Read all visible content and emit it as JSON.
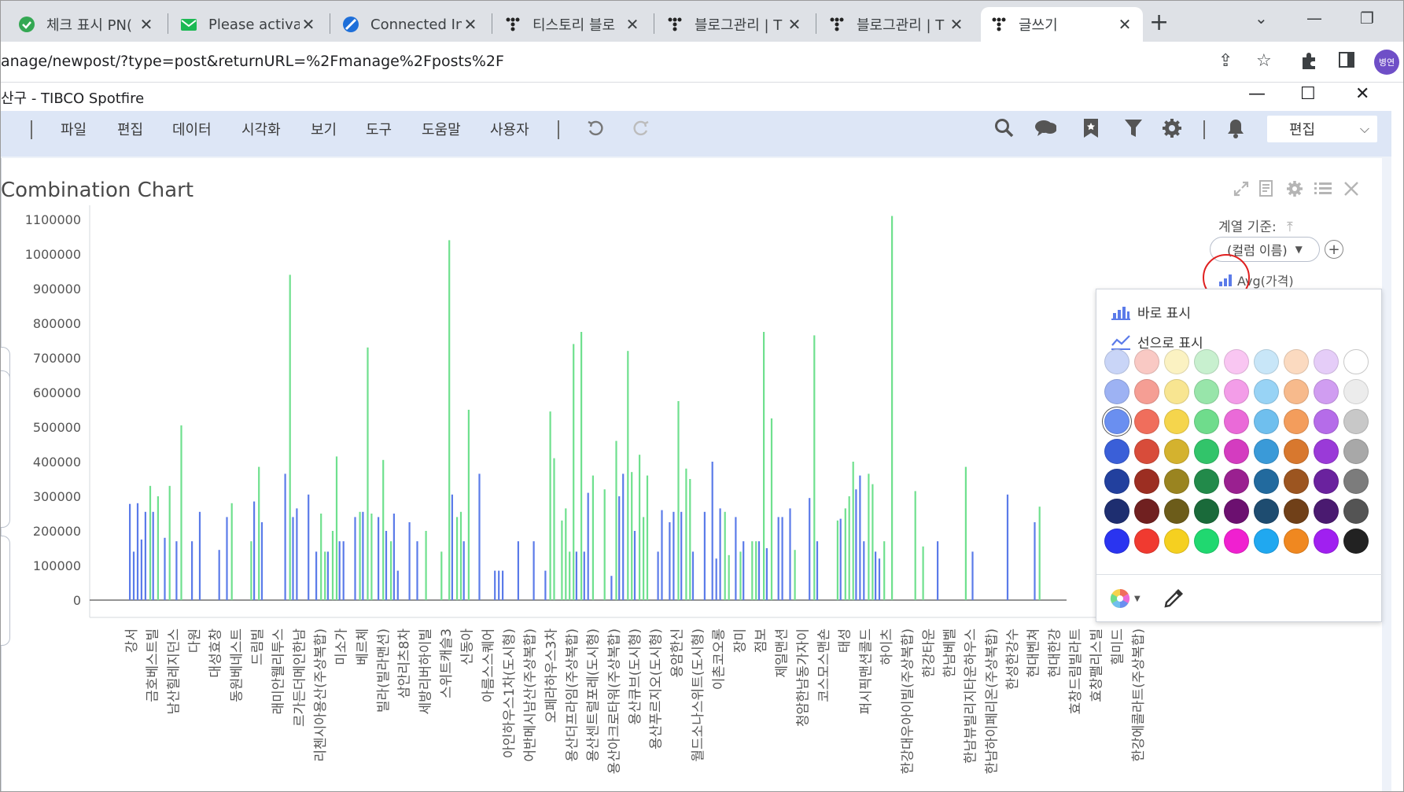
{
  "browser": {
    "tabs": [
      {
        "title": "체크 표시 PN(",
        "icon": "green-check-icon"
      },
      {
        "title": "Please activat",
        "icon": "green-mail-icon"
      },
      {
        "title": "Connected In",
        "icon": "blue-compass-icon"
      },
      {
        "title": "티스토리 블로",
        "icon": "tistory-icon"
      },
      {
        "title": "블로그관리 | T",
        "icon": "tistory-icon"
      },
      {
        "title": "블로그관리 | T",
        "icon": "tistory-icon"
      },
      {
        "title": "글쓰기",
        "icon": "tistory-icon"
      }
    ],
    "url": "anage/newpost/?type=post&returnURL=%2Fmanage%2Fposts%2F",
    "profile": "병연"
  },
  "app": {
    "title": "산구 - TIBCO Spotfire",
    "menu": [
      "파일",
      "편집",
      "데이터",
      "시각화",
      "보기",
      "도구",
      "도움말",
      "사용자"
    ],
    "mode": "편집"
  },
  "chart": {
    "title": "Combination Chart",
    "legend_label": "계열 기준:",
    "legend_dropdown": "(컬럼 이름)",
    "legend_item": "Avg(가격)"
  },
  "popup": {
    "bar_option": "바로 표시",
    "line_option": "선으로 표시",
    "colors": [
      [
        "#c9d5f7",
        "#f9c9c4",
        "#fbf2c2",
        "#c8f0cf",
        "#f9c6f2",
        "#c8e6f8",
        "#fbdac0",
        "#e5cdf8",
        "#ffffff"
      ],
      [
        "#9db2f3",
        "#f59e94",
        "#f8e591",
        "#98e5aa",
        "#f39de8",
        "#98d3f5",
        "#f7ba8c",
        "#d09df1",
        "#ececec"
      ],
      [
        "#6a8ff0",
        "#f06e5c",
        "#f5d54c",
        "#6fdc8c",
        "#ea6ad8",
        "#6fbfee",
        "#f39d5c",
        "#b56ce9",
        "#c8c8c8"
      ],
      [
        "#3a5fd8",
        "#d84c3a",
        "#d4b22e",
        "#32c46a",
        "#d43cc0",
        "#3a9ad8",
        "#d8782e",
        "#9a3ad8",
        "#a8a8a8"
      ],
      [
        "#22409e",
        "#9c2e22",
        "#9a8420",
        "#228a4a",
        "#9a2090",
        "#226a9e",
        "#9c5520",
        "#6a229e",
        "#7c7c7c"
      ],
      [
        "#1e2e70",
        "#702020",
        "#6c5c1a",
        "#1a6a3a",
        "#6c1070",
        "#1e4c70",
        "#704018",
        "#4a1a70",
        "#545454"
      ],
      [
        "#2a34f0",
        "#f03a30",
        "#f5d020",
        "#20d870",
        "#f020d0",
        "#20a8f0",
        "#f08820",
        "#a020f0",
        "#222222"
      ]
    ]
  },
  "chart_data": {
    "type": "bar",
    "title": "Combination Chart",
    "yticks": [
      "1100000",
      "1000000",
      "900000",
      "800000",
      "700000",
      "600000",
      "500000",
      "400000",
      "300000",
      "200000",
      "100000",
      "0"
    ],
    "ylim": [
      0,
      1100000
    ],
    "series": [
      {
        "name": "Avg(가격)",
        "color": "#5b7be9"
      },
      {
        "name": "",
        "color": "#6fe08e"
      }
    ],
    "x_labels": [
      "강서",
      "금호베스트빌",
      "남산힐레지던스",
      "다원",
      "대성효창",
      "동원베네스트",
      "드림빌",
      "래미안웰리투스",
      "르가든더메인한남",
      "리첸시아용산(주상복합)",
      "미소가",
      "베르체",
      "빌라(빌라맨션)",
      "삼안리츠8차",
      "세방리버하이빌",
      "스위트캐슬3",
      "신동아",
      "아름스스퀘어",
      "아인하우스1차(도시형)",
      "어반메시남산(주상복합)",
      "오페라하우스3차",
      "용산더프라임(주상복합)",
      "용산센트럴포레(도시형)",
      "용산아크로타워(주상복합)",
      "용산큐브(도시형)",
      "용산푸르지오(도시형)",
      "용암한신",
      "월드소나스위트(도시형)",
      "이촌코오롱",
      "장미",
      "점보",
      "제일맨션",
      "청암한남동가자이",
      "코스모스맨숀",
      "태성",
      "퍼시픽맨션콜드",
      "하이츠",
      "한강대우아이빌(주상복합)",
      "한강타운",
      "한남베벨",
      "한남뷰빌리지타운하우스",
      "한남하이페리온(주상복합)",
      "한성한강수",
      "현대벤쳐",
      "현대한강",
      "효창드림빌라트",
      "효창팰리스빌",
      "힐미드",
      "한강에콜라트(주상복합)"
    ],
    "bars": [
      [
        0,
        278000,
        0
      ],
      [
        1,
        140000,
        0
      ],
      [
        2,
        280000,
        0
      ],
      [
        3,
        175000,
        0
      ],
      [
        4,
        255000,
        0
      ],
      [
        5,
        0,
        330000
      ],
      [
        6,
        255000,
        0
      ],
      [
        7,
        0,
        300000
      ],
      [
        9,
        180000,
        0
      ],
      [
        10,
        0,
        330000
      ],
      [
        12,
        170000,
        0
      ],
      [
        13,
        0,
        505000
      ],
      [
        16,
        170000,
        0
      ],
      [
        18,
        255000,
        0
      ],
      [
        23,
        145000,
        0
      ],
      [
        25,
        240000,
        0
      ],
      [
        26,
        0,
        280000
      ],
      [
        31,
        0,
        170000
      ],
      [
        32,
        285000,
        0
      ],
      [
        33,
        0,
        385000
      ],
      [
        34,
        225000,
        0
      ],
      [
        40,
        365000,
        0
      ],
      [
        41,
        0,
        940000
      ],
      [
        42,
        240000,
        0
      ],
      [
        43,
        265000,
        0
      ],
      [
        46,
        305000,
        0
      ],
      [
        48,
        140000,
        0
      ],
      [
        49,
        0,
        250000
      ],
      [
        50,
        0,
        140000
      ],
      [
        51,
        140000,
        0
      ],
      [
        52,
        0,
        200000
      ],
      [
        53,
        0,
        415000
      ],
      [
        54,
        170000,
        0
      ],
      [
        55,
        170000,
        0
      ],
      [
        58,
        240000,
        0
      ],
      [
        59,
        0,
        255000
      ],
      [
        60,
        255000,
        0
      ],
      [
        61,
        0,
        730000
      ],
      [
        62,
        0,
        250000
      ],
      [
        64,
        240000,
        0
      ],
      [
        65,
        0,
        405000
      ],
      [
        66,
        200000,
        0
      ],
      [
        67,
        0,
        170000
      ],
      [
        68,
        250000,
        0
      ],
      [
        69,
        85000,
        0
      ],
      [
        72,
        225000,
        0
      ],
      [
        74,
        170000,
        0
      ],
      [
        76,
        0,
        200000
      ],
      [
        80,
        0,
        140000
      ],
      [
        82,
        0,
        1040000
      ],
      [
        83,
        305000,
        0
      ],
      [
        84,
        0,
        240000
      ],
      [
        85,
        0,
        255000
      ],
      [
        86,
        170000,
        0
      ],
      [
        87,
        0,
        550000
      ],
      [
        90,
        365000,
        0
      ],
      [
        94,
        85000,
        0
      ],
      [
        95,
        85000,
        0
      ],
      [
        96,
        85000,
        0
      ],
      [
        100,
        170000,
        0
      ],
      [
        104,
        170000,
        0
      ],
      [
        107,
        85000,
        0
      ],
      [
        108,
        0,
        545000
      ],
      [
        109,
        0,
        410000
      ],
      [
        111,
        0,
        230000
      ],
      [
        112,
        0,
        265000
      ],
      [
        113,
        0,
        140000
      ],
      [
        114,
        0,
        740000
      ],
      [
        115,
        140000,
        0
      ],
      [
        116,
        0,
        775000
      ],
      [
        117,
        140000,
        0
      ],
      [
        118,
        310000,
        0
      ],
      [
        119,
        0,
        360000
      ],
      [
        122,
        0,
        320000
      ],
      [
        124,
        70000,
        0
      ],
      [
        125,
        0,
        460000
      ],
      [
        126,
        300000,
        0
      ],
      [
        127,
        365000,
        0
      ],
      [
        128,
        0,
        720000
      ],
      [
        129,
        0,
        370000
      ],
      [
        130,
        200000,
        0
      ],
      [
        131,
        0,
        420000
      ],
      [
        132,
        0,
        240000
      ],
      [
        133,
        0,
        360000
      ],
      [
        136,
        140000,
        0
      ],
      [
        137,
        260000,
        0
      ],
      [
        139,
        225000,
        0
      ],
      [
        140,
        255000,
        0
      ],
      [
        141,
        0,
        575000
      ],
      [
        142,
        255000,
        0
      ],
      [
        143,
        0,
        380000
      ],
      [
        144,
        0,
        350000
      ],
      [
        145,
        140000,
        0
      ],
      [
        148,
        255000,
        0
      ],
      [
        150,
        400000,
        0
      ],
      [
        151,
        120000,
        0
      ],
      [
        152,
        265000,
        0
      ],
      [
        153,
        0,
        255000
      ],
      [
        154,
        0,
        130000
      ],
      [
        156,
        240000,
        0
      ],
      [
        157,
        0,
        140000
      ],
      [
        158,
        170000,
        0
      ],
      [
        160,
        0,
        170000
      ],
      [
        161,
        0,
        170000
      ],
      [
        162,
        170000,
        0
      ],
      [
        163,
        0,
        775000
      ],
      [
        164,
        150000,
        0
      ],
      [
        165,
        0,
        525000
      ],
      [
        167,
        240000,
        0
      ],
      [
        168,
        240000,
        0
      ],
      [
        170,
        265000,
        0
      ],
      [
        171,
        0,
        145000
      ],
      [
        175,
        295000,
        0
      ],
      [
        176,
        0,
        765000
      ],
      [
        177,
        170000,
        0
      ],
      [
        182,
        0,
        230000
      ],
      [
        183,
        235000,
        0
      ],
      [
        184,
        0,
        265000
      ],
      [
        185,
        0,
        300000
      ],
      [
        186,
        0,
        400000
      ],
      [
        187,
        320000,
        0
      ],
      [
        188,
        360000,
        0
      ],
      [
        189,
        170000,
        0
      ],
      [
        190,
        0,
        365000
      ],
      [
        191,
        0,
        335000
      ],
      [
        192,
        140000,
        0
      ],
      [
        193,
        120000,
        0
      ],
      [
        194,
        0,
        170000
      ],
      [
        196,
        0,
        1110000
      ],
      [
        202,
        0,
        315000
      ],
      [
        204,
        0,
        155000
      ],
      [
        208,
        170000,
        0
      ],
      [
        215,
        0,
        385000
      ],
      [
        217,
        140000,
        0
      ],
      [
        226,
        305000,
        0
      ],
      [
        233,
        225000,
        0
      ],
      [
        234,
        0,
        270000
      ]
    ]
  }
}
